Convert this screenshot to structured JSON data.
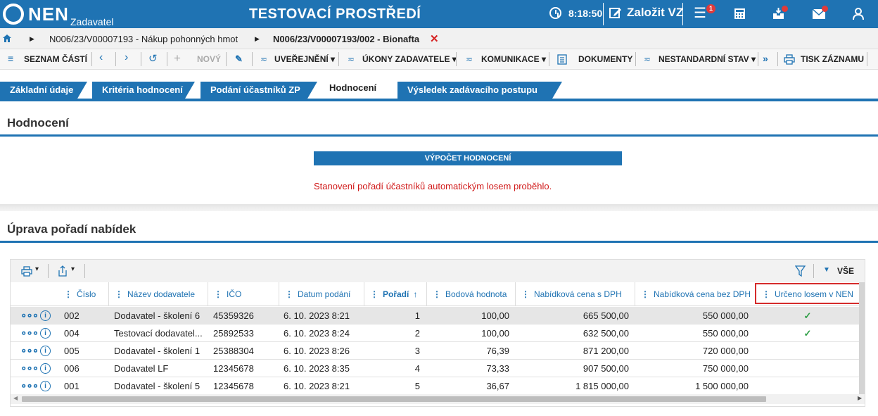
{
  "header": {
    "logo": "NEN",
    "logo_sub": "Zadavatel",
    "environment": "TESTOVACÍ PROSTŘEDÍ",
    "time": "8:18:50",
    "create_label": "Založit VZ",
    "notification_count": "1"
  },
  "breadcrumb": {
    "item1": "N006/23/V00007193 - Nákup pohonných hmot",
    "item2": "N006/23/V00007193/002 - Bionafta"
  },
  "toolbar": {
    "parts": "SEZNAM ČÁSTÍ",
    "new": "NOVÝ",
    "publish": "UVEŘEJNĚNÍ",
    "acts": "ÚKONY ZADAVATELE",
    "comm": "KOMUNIKACE",
    "docs": "DOKUMENTY",
    "nonstd": "NESTANDARDNÍ STAV",
    "print": "TISK ZÁZNAMU"
  },
  "tabs": [
    "Základní údaje",
    "Kritéria hodnocení",
    "Podání účastníků ZP",
    "Hodnocení",
    "Výsledek zadávacího postupu"
  ],
  "evaluation": {
    "title": "Hodnocení",
    "button": "VÝPOČET HODNOCENÍ",
    "message": "Stanovení pořadí účastníků automatickým losem proběhlo."
  },
  "ordering": {
    "title": "Úprava pořadí nabídek",
    "filter_label": "VŠE",
    "columns": [
      "Číslo",
      "Název dodavatele",
      "IČO",
      "Datum podání",
      "Pořadí",
      "Bodová hodnota",
      "Nabídková cena s DPH",
      "Nabídková cena bez DPH",
      "Určeno losem v NEN"
    ],
    "rows": [
      [
        "002",
        "Dodavatel - školení 6",
        "45359326",
        "6. 10. 2023 8:21",
        "1",
        "100,00",
        "665 500,00",
        "550 000,00",
        "✓"
      ],
      [
        "004",
        "Testovací dodavatel...",
        "25892533",
        "6. 10. 2023 8:24",
        "2",
        "100,00",
        "632 500,00",
        "550 000,00",
        "✓"
      ],
      [
        "005",
        "Dodavatel - školení 1",
        "25388304",
        "6. 10. 2023 8:26",
        "3",
        "76,39",
        "871 200,00",
        "720 000,00",
        ""
      ],
      [
        "006",
        "Dodavatel LF",
        "12345678",
        "6. 10. 2023 8:35",
        "4",
        "73,33",
        "907 500,00",
        "750 000,00",
        ""
      ],
      [
        "001",
        "Dodavatel - školení 5",
        "12345678",
        "6. 10. 2023 8:21",
        "5",
        "36,67",
        "1 815 000,00",
        "1 500 000,00",
        ""
      ]
    ]
  }
}
